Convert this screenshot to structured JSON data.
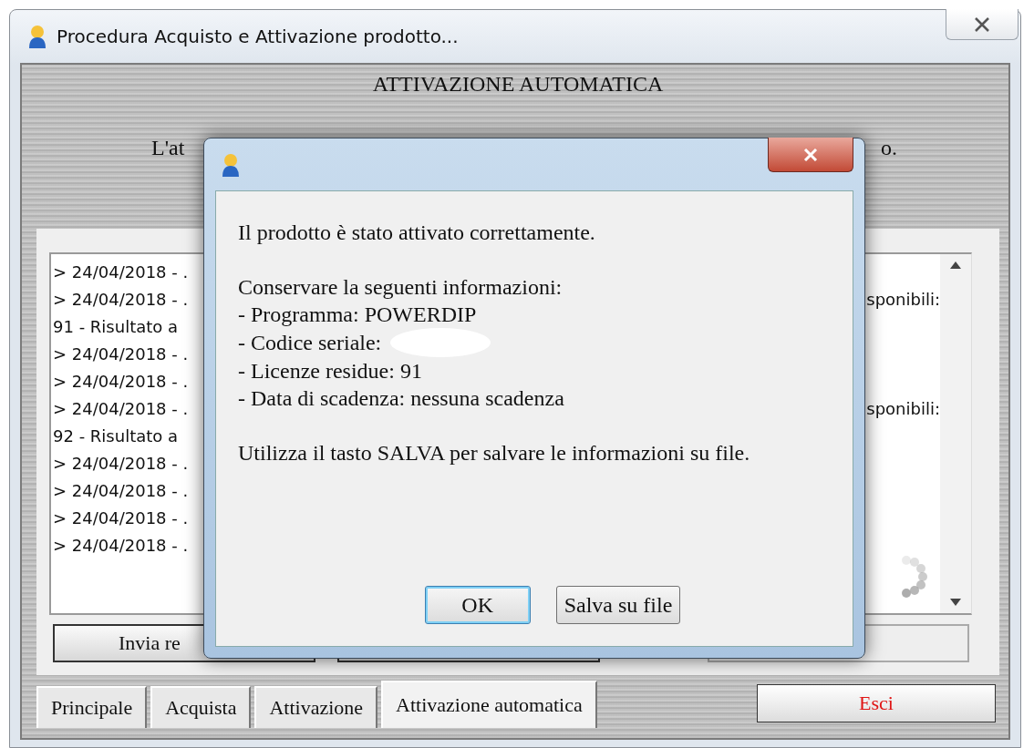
{
  "window": {
    "title": "Procedura Acquisto e Attivazione prodotto..."
  },
  "heading": "ATTIVAZIONE AUTOMATICA",
  "intro": {
    "left": "L'at",
    "right": "o."
  },
  "log": [
    {
      "left": "> 24/04/2018 - ."
    },
    {
      "left": "> 24/04/2018 - .",
      "right": "sponibili:"
    },
    {
      "left": "91  - Risultato a"
    },
    {
      "left": "> 24/04/2018 - ."
    },
    {
      "left": "> 24/04/2018 - ."
    },
    {
      "left": "> 24/04/2018 - .",
      "right": "sponibili:"
    },
    {
      "left": "92  - Risultato a"
    },
    {
      "left": "> 24/04/2018 - ."
    },
    {
      "left": "> 24/04/2018 - ."
    },
    {
      "left": "> 24/04/2018 - ."
    },
    {
      "left": "> 24/04/2018 - ."
    }
  ],
  "buttons": [
    "Invia re"
  ],
  "tabs": [
    {
      "label": "Principale",
      "selected": false
    },
    {
      "label": "Acquista",
      "selected": false
    },
    {
      "label": "Attivazione",
      "selected": false
    },
    {
      "label": "Attivazione automatica",
      "selected": true
    }
  ],
  "exit_button": "Esci",
  "dialog": {
    "message": "Il prodotto è stato attivato correttamente.",
    "info_title": "Conservare la seguenti informazioni:",
    "info": [
      {
        "text": "- Programma: POWERDIP",
        "redacted": false
      },
      {
        "text": "- Codice seriale:",
        "redacted": true
      },
      {
        "text": "- Licenze residue: 91",
        "redacted": false
      },
      {
        "text": "- Data di scadenza: nessuna scadenza",
        "redacted": false
      }
    ],
    "hint": "Utilizza il tasto SALVA per salvare le informazioni su file.",
    "buttons": [
      {
        "label": "OK",
        "selected": true
      },
      {
        "label": "Salva su file",
        "selected": false
      }
    ]
  }
}
